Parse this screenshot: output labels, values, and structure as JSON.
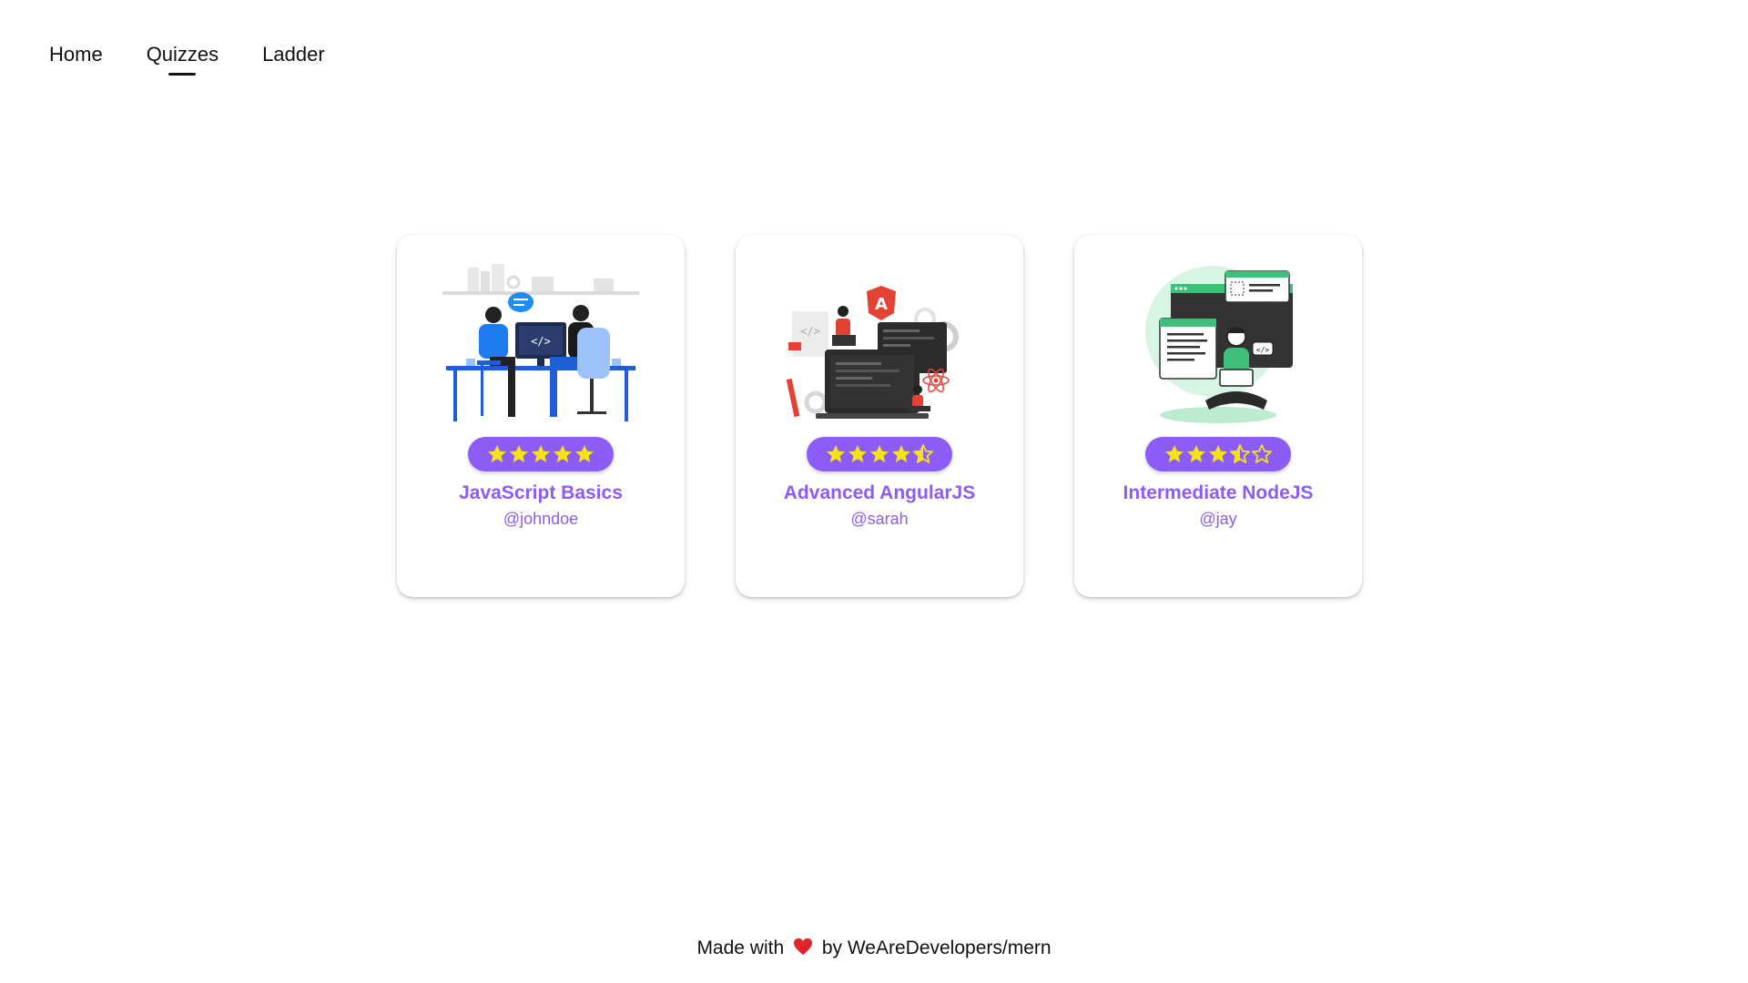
{
  "nav": {
    "items": [
      {
        "label": "Home",
        "active": false
      },
      {
        "label": "Quizzes",
        "active": true
      },
      {
        "label": "Ladder",
        "active": false
      }
    ]
  },
  "cards": [
    {
      "title": "JavaScript Basics",
      "author": "@johndoe",
      "rating": 5,
      "illustration": "developers-at-desk-illustration"
    },
    {
      "title": "Advanced AngularJS",
      "author": "@sarah",
      "rating": 4.5,
      "illustration": "angular-laptops-illustration"
    },
    {
      "title": "Intermediate NodeJS",
      "author": "@jay",
      "rating": 3.5,
      "illustration": "person-with-laptop-illustration"
    }
  ],
  "footer": {
    "prefix": "Made with",
    "suffix": "by WeAreDevelopers/mern",
    "icon": "heart-icon"
  },
  "colors": {
    "accent": "#8b5cf6",
    "star": "#f5e31a",
    "heart": "#e0242b"
  }
}
